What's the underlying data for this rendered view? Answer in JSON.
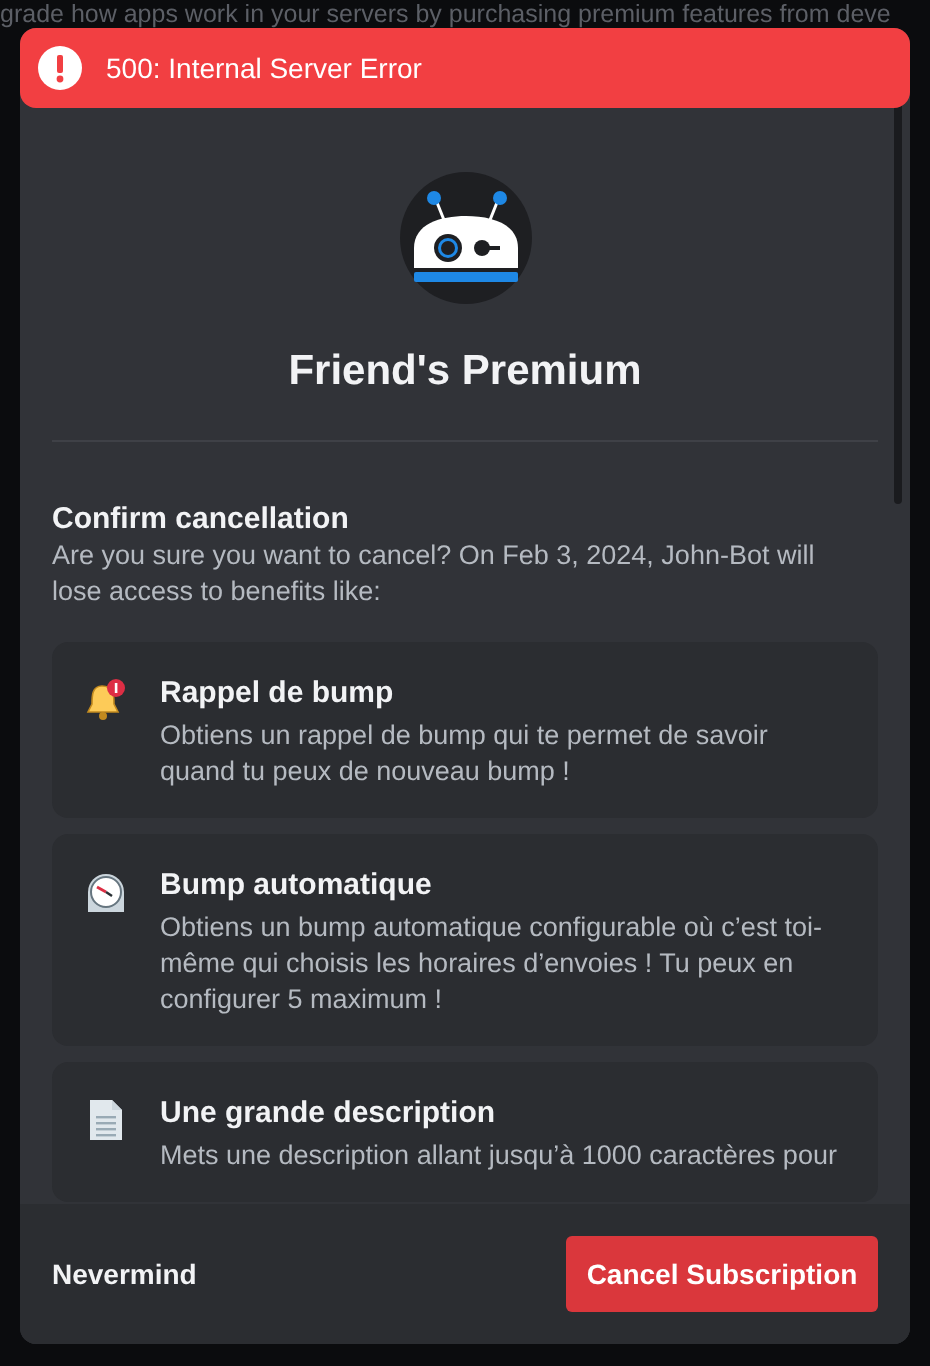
{
  "background": {
    "text": "grade how apps work in your servers by purchasing premium features from deve"
  },
  "error_toast": {
    "text": "500: Internal Server Error"
  },
  "modal": {
    "title": "Friend's Premium",
    "heading": "Confirm cancellation",
    "description": "Are you sure you want to cancel? On Feb 3, 2024, John-Bot will lose access to benefits like:",
    "benefits": [
      {
        "kind": "bell",
        "title": "Rappel de bump",
        "description": "Obtiens un rappel de bump qui te permet de savoir quand tu peux de nouveau bump !"
      },
      {
        "kind": "clock",
        "title": "Bump automatique",
        "description": "Obtiens un bump automatique configurable où c’est toi-même qui choisis les horaires d’envoies ! Tu peux en configurer 5 maximum !"
      },
      {
        "kind": "document",
        "title": "Une grande description",
        "description": "Mets une description allant jusqu’à 1000 caractères pour"
      }
    ],
    "buttons": {
      "secondary": "Nevermind",
      "primary": "Cancel Subscription"
    }
  }
}
